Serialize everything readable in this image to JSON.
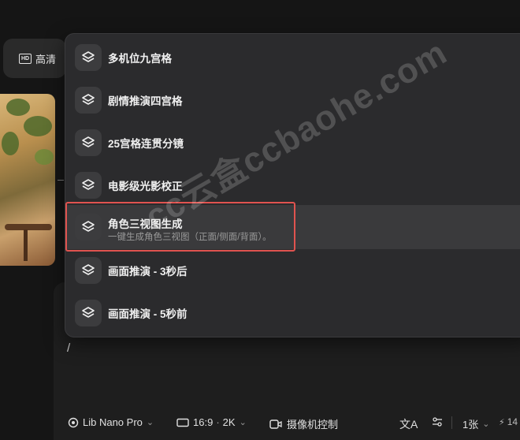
{
  "quality": {
    "badge": "HD",
    "label": "高清"
  },
  "menu": {
    "items": [
      {
        "label": "多机位九宫格",
        "icon": "layers-icon"
      },
      {
        "label": "剧情推演四宫格",
        "icon": "layers-icon"
      },
      {
        "label": "25宫格连贯分镜",
        "icon": "layers-icon"
      },
      {
        "label": "电影级光影校正",
        "icon": "layers-icon"
      },
      {
        "label": "角色三视图生成",
        "icon": "layers-icon",
        "description": "一键生成角色三视图（正面/侧面/背面）。",
        "highlighted": true
      },
      {
        "label": "画面推演 - 3秒后",
        "icon": "layers-icon"
      },
      {
        "label": "画面推演 - 5秒前",
        "icon": "layers-icon"
      }
    ]
  },
  "prompt": {
    "value": "/"
  },
  "toolbar": {
    "model": "Lib Nano Pro",
    "aspect": "16:9",
    "resolution": "2K",
    "camera": "摄像机控制",
    "count": "1张",
    "credits": "14"
  },
  "watermark": "cc云盒ccbaohe.com",
  "colors": {
    "highlight_box": "#e0534f",
    "panel": "#2b2b2d",
    "background": "#151515"
  }
}
